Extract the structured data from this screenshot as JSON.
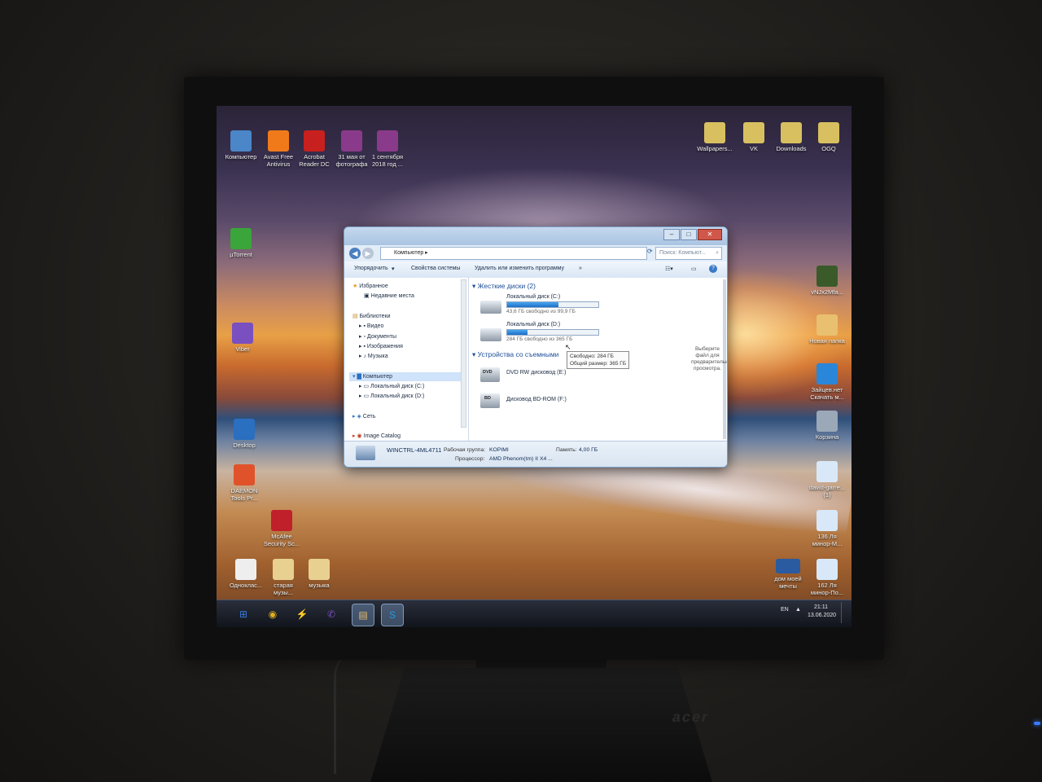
{
  "desktop_icons_left_top": [
    {
      "label": "Компьютер",
      "icon": "computer-icon",
      "color": "#4a86c8"
    },
    {
      "label": "Avast Free\nAntivirus",
      "icon": "avast-icon",
      "color": "#f07a1a"
    },
    {
      "label": "Acrobat\nReader DC",
      "icon": "acrobat-icon",
      "color": "#c8201e"
    },
    {
      "label": "31 мая от\nфотографа",
      "icon": "archive-icon",
      "color": "#8a3a8a"
    },
    {
      "label": "1 сентября\n2018 год ...",
      "icon": "archive-icon",
      "color": "#8a3a8a"
    }
  ],
  "desktop_icons_left_column": [
    {
      "label": "µTorrent",
      "icon": "utorrent-icon",
      "color": "#3aa53a"
    },
    {
      "label": "Viber",
      "icon": "viber-icon",
      "color": "#7a4fc0"
    },
    {
      "label": "Desktop",
      "icon": "desktop-icon",
      "color": "#2a6fc0"
    },
    {
      "label": "DAEMON\nTools Pr...",
      "icon": "daemon-tools-icon",
      "color": "#e0522a"
    },
    {
      "label": "McAfee\nSecurity Sc...",
      "icon": "mcafee-icon",
      "color": "#c0202a"
    }
  ],
  "desktop_icons_bottom": [
    {
      "label": "Одноклас...",
      "icon": "file-icon",
      "color": "#eeeeee"
    },
    {
      "label": "старая\nмузы...",
      "icon": "folder-icon",
      "color": "#e8d090"
    },
    {
      "label": "музыка",
      "icon": "folder-icon",
      "color": "#e8d090"
    }
  ],
  "desktop_icons_right_top": [
    {
      "label": "Wallpapers...",
      "icon": "folder-icon",
      "color": "#d8c060"
    },
    {
      "label": "VK",
      "icon": "folder-icon",
      "color": "#d8c060"
    },
    {
      "label": "Downloads",
      "icon": "folder-icon",
      "color": "#d8c060"
    },
    {
      "label": "OGQ",
      "icon": "folder-icon",
      "color": "#d8c060"
    }
  ],
  "desktop_icons_right_column": [
    {
      "label": "vNJx2Mfa...",
      "icon": "image-icon",
      "color": "#3a5a2a"
    },
    {
      "label": "Новая папка",
      "icon": "folder-icon",
      "color": "#e8c070"
    },
    {
      "label": "Зайцев.нет\nСкачать м...",
      "icon": "ie-icon",
      "color": "#2a86d8"
    },
    {
      "label": "Корзина",
      "icon": "recycle-bin-icon",
      "color": "#9aa8b8"
    },
    {
      "label": "david-garre...\n(1)",
      "icon": "mp3-icon",
      "color": "#d8e8f8"
    },
    {
      "label": "136 Ля\nминор-М...",
      "icon": "mp3-icon",
      "color": "#d8e8f8"
    },
    {
      "label": "162 Ля\nминор-По...",
      "icon": "mp3-icon",
      "color": "#d8e8f8"
    }
  ],
  "desktop_icon_dream_house": {
    "label": "дом моей\nмечты",
    "icon": "image-icon",
    "color": "#2a5aa0"
  },
  "explorer": {
    "address": "Компьютер",
    "search_placeholder": "Поиск: Компьют...",
    "toolbar": {
      "organize": "Упорядочить",
      "system_properties": "Свойства системы",
      "uninstall": "Удалить или изменить программу",
      "more": "»"
    },
    "nav": {
      "favorites": "Избранное",
      "recent": "Недавние места",
      "libraries": "Библиотеки",
      "video": "Видео",
      "documents": "Документы",
      "images": "Изображения",
      "music": "Музыка",
      "computer": "Компьютер",
      "drive_c": "Локальный диск (C:)",
      "drive_d": "Локальный диск (D:)",
      "network": "Сеть",
      "image_catalog": "Image Catalog"
    },
    "groups": {
      "hard_disks": "Жесткие диски (2)",
      "removable": "Устройства со съемными"
    },
    "drives": [
      {
        "name": "Локальный диск (C:)",
        "free_text": "43,6 ГБ свободно из 99,9 ГБ",
        "used_fraction": 0.56
      },
      {
        "name": "Локальный диск (D:)",
        "free_text": "284 ГБ свободно из 365 ГБ",
        "used_fraction": 0.22
      }
    ],
    "removable_devices": [
      {
        "name": "DVD RW дисковод (E:)",
        "badge": "DVD"
      },
      {
        "name": "Дисковод BD-ROM (F:)",
        "badge": "BD"
      }
    ],
    "tooltip": "Свободно: 284 ГБ\nОбщий размер: 365 ГБ",
    "preview_hint": "Выберите\nфайл для\nпредварительного\nпросмотра.",
    "details": {
      "computer_name": "WINCTRL-4ML4711",
      "workgroup_label": "Рабочая группа:",
      "workgroup_value": "KOPIMI",
      "memory_label": "Память:",
      "memory_value": "4,00 ГБ",
      "processor_label": "Процессор:",
      "processor_value": "AMD Phenom(tm) II X4 ..."
    }
  },
  "taskbar": {
    "language": "EN",
    "time": "21:11",
    "date": "13.06.2020",
    "apps": [
      {
        "icon": "start-orb-icon",
        "color": "#3a7ad8"
      },
      {
        "icon": "chrome-icon",
        "color": "#e0b020"
      },
      {
        "icon": "daemon-tools-icon",
        "color": "#e0522a"
      },
      {
        "icon": "viber-icon",
        "color": "#7a4fc0"
      },
      {
        "icon": "explorer-icon",
        "color": "#e8c070"
      },
      {
        "icon": "skype-icon",
        "color": "#2a9ae0"
      }
    ]
  },
  "monitor_brand": "acer"
}
